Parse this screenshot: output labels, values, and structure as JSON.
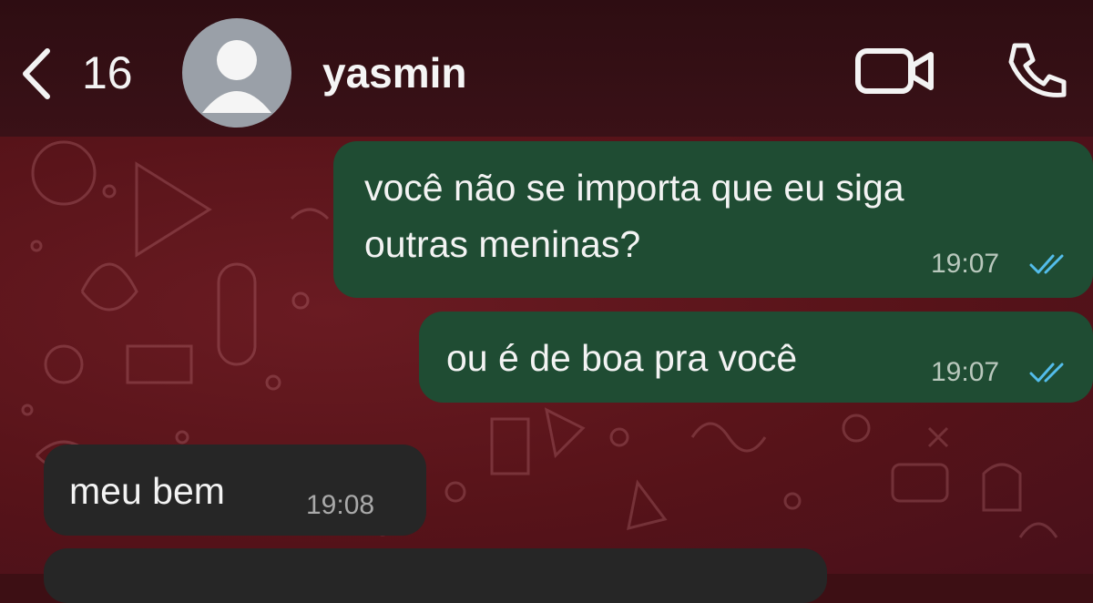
{
  "header": {
    "back_count": "16",
    "contact_name": "yasmin"
  },
  "messages": [
    {
      "direction": "outgoing",
      "lines": [
        "você não se importa que eu siga",
        "outras meninas?"
      ],
      "time": "19:07",
      "status": "read"
    },
    {
      "direction": "outgoing",
      "lines": [
        "ou é de boa pra você"
      ],
      "time": "19:07",
      "status": "read"
    },
    {
      "direction": "incoming",
      "lines": [
        "meu bem"
      ],
      "time": "19:08"
    }
  ],
  "colors": {
    "outgoing_bubble": "#1f4c33",
    "incoming_bubble": "#262626",
    "read_ticks": "#53bdeb",
    "wallpaper": "#571319"
  },
  "icons": {
    "back": "chevron-left-icon",
    "avatar": "user-placeholder-icon",
    "video": "video-camera-icon",
    "call": "phone-icon",
    "read": "double-check-icon"
  }
}
